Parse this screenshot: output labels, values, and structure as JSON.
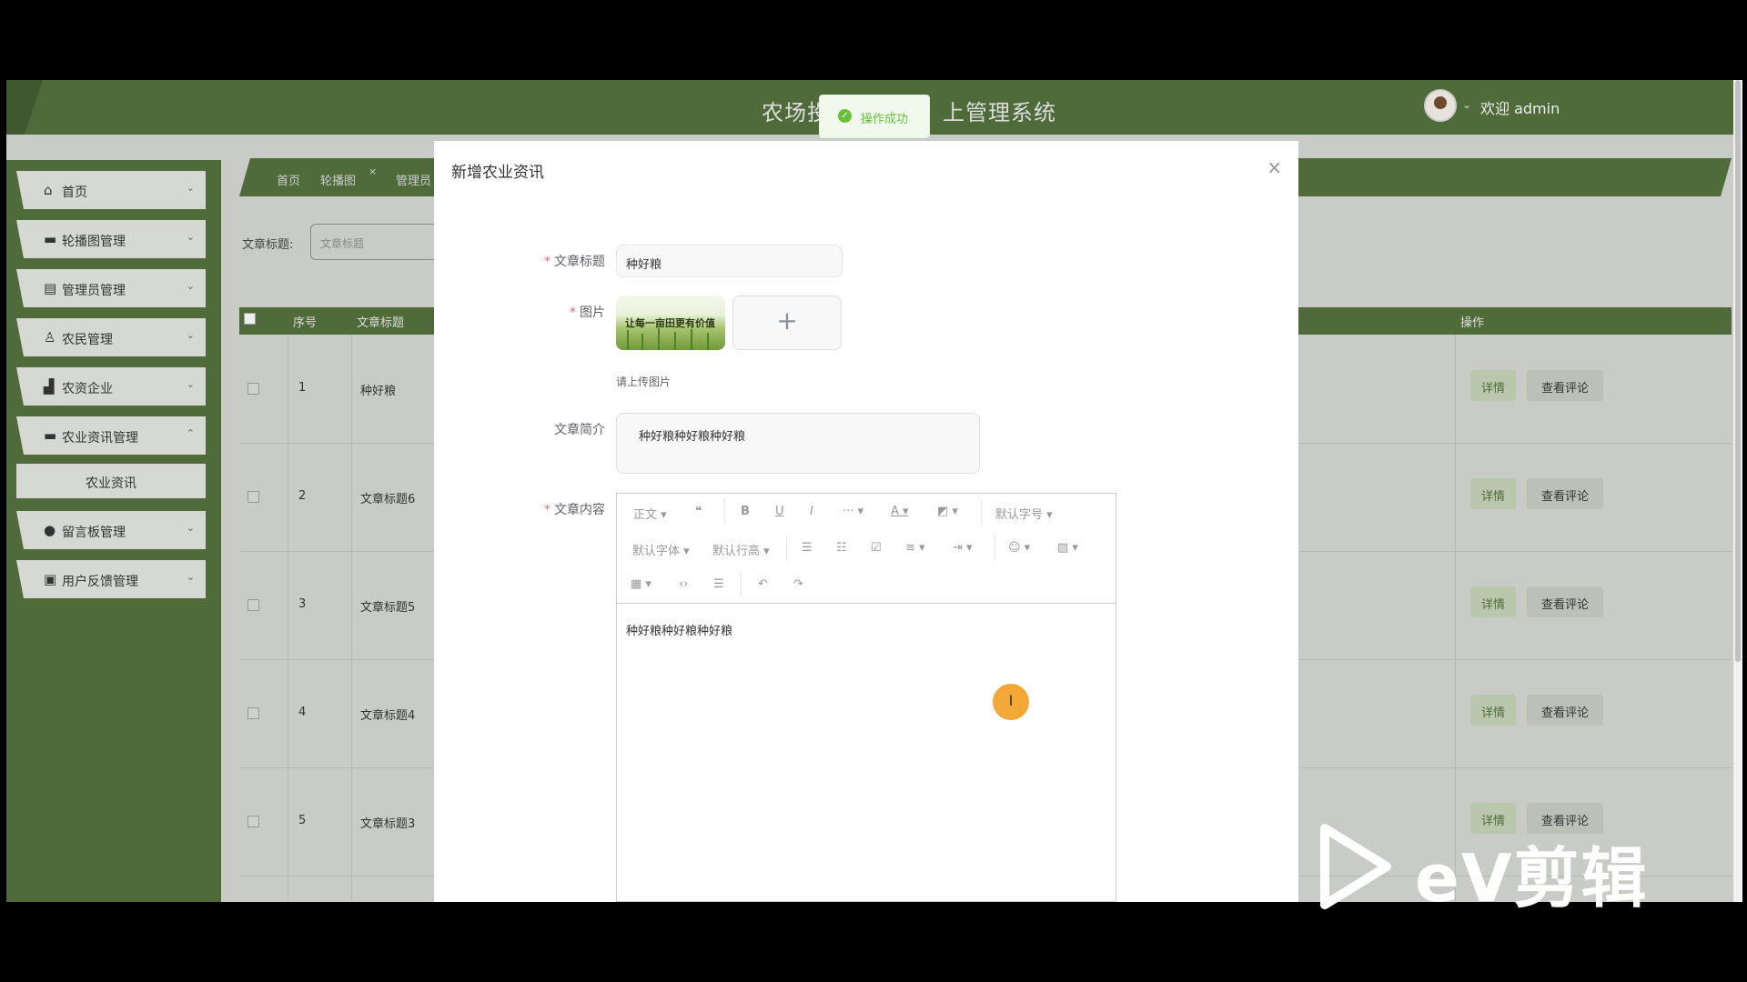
{
  "header": {
    "app_title_left": "农场投",
    "app_title_right": "上管理系统",
    "welcome": "欢迎 admin"
  },
  "toast": {
    "message": "操作成功"
  },
  "sidebar": {
    "items": [
      {
        "label": "首页",
        "icon": "home-icon"
      },
      {
        "label": "轮播图管理",
        "icon": "image-icon"
      },
      {
        "label": "管理员管理",
        "icon": "admin-icon"
      },
      {
        "label": "农民管理",
        "icon": "user-icon"
      },
      {
        "label": "农资企业",
        "icon": "company-icon"
      },
      {
        "label": "农业资讯管理",
        "icon": "news-icon"
      },
      {
        "label": "留言板管理",
        "icon": "message-icon"
      },
      {
        "label": "用户反馈管理",
        "icon": "feedback-icon"
      }
    ],
    "sub_item": "农业资讯"
  },
  "breadcrumb": {
    "home": "首页",
    "carousel": "轮播图",
    "admin": "管理员"
  },
  "filter": {
    "label": "文章标题:",
    "placeholder": "文章标题"
  },
  "table": {
    "headers": {
      "index": "序号",
      "title": "文章标题",
      "actions": "操作"
    },
    "rows": [
      {
        "index": "1",
        "title": "种好粮"
      },
      {
        "index": "2",
        "title": "文章标题6"
      },
      {
        "index": "3",
        "title": "文章标题5"
      },
      {
        "index": "4",
        "title": "文章标题4"
      },
      {
        "index": "5",
        "title": "文章标题3"
      }
    ],
    "detail_label": "详情",
    "comment_label": "查看评论"
  },
  "modal": {
    "title": "新增农业资讯",
    "close": "×",
    "fields": {
      "title_label": "文章标题",
      "title_value": "种好粮",
      "image_label": "图片",
      "image_caption": "让每一亩田更有价值",
      "upload_plus": "+",
      "upload_tip": "请上传图片",
      "intro_label": "文章简介",
      "intro_value": "种好粮种好粮种好粮",
      "content_label": "文章内容",
      "content_value": "种好粮种好粮种好粮"
    },
    "editor_toolbar": {
      "heading": "正文",
      "font_size": "默认字号",
      "font_family": "默认字体",
      "line_height": "默认行高"
    }
  },
  "watermark": {
    "text": "eV剪辑"
  }
}
